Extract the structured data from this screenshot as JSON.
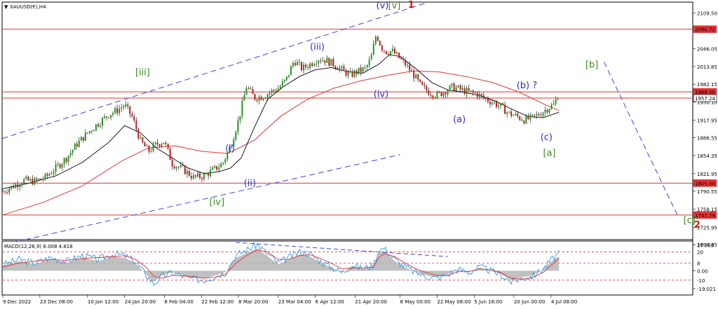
{
  "header": {
    "symbol_label": "XAUUSD(€),H4"
  },
  "macd_label": "MACD(12,26,9) 8.008 4.818",
  "colors": {
    "frame": "#000000",
    "price_line": "#000000",
    "candle_up": "#1a9a1a",
    "candle_down": "#c01818",
    "ma_fast": "#000000",
    "ma_slow": "#e53333",
    "hline": "#e53333",
    "channel": "#3b45d8",
    "projection": "#3b45d8",
    "wave_blue": "#3030c8",
    "wave_green": "#3d8a1f",
    "wave_red": "#dd1111",
    "macd_hist": "#b0b0b0",
    "macd_line": "#3a9ae0",
    "macd_signal": "#e03030",
    "macd_level": "#e53333"
  },
  "chart_data": {
    "type": "line",
    "title": "XAUUSD(€),H4",
    "price_axis": {
      "ylim": [
        1705,
        2128
      ],
      "ticks": [
        "2109.50",
        "2078.45",
        "2046.05",
        "2013.85",
        "1982.15",
        "1950.10",
        "1917.95",
        "1886.55",
        "1854.35",
        "1821.95",
        "1790.55",
        "1758.15",
        "1725.95",
        "1694.65"
      ]
    },
    "macd_axis": {
      "ylim": [
        -25,
        30
      ],
      "ticks": [
        "27.553",
        "0.00",
        "-19.021"
      ]
    },
    "time_axis": {
      "span_days": 215,
      "ticks": [
        {
          "label": "9 Dec 2022",
          "day": 0
        },
        {
          "label": "23 Dec 08:00",
          "day": 14
        },
        {
          "label": "10 Jan 12:00",
          "day": 32
        },
        {
          "label": "24 Jan 20:00",
          "day": 46
        },
        {
          "label": "8 Feb 04:00",
          "day": 61
        },
        {
          "label": "22 Feb 12:00",
          "day": 75
        },
        {
          "label": "8 Mar 20:00",
          "day": 89
        },
        {
          "label": "23 Mar 04:00",
          "day": 104
        },
        {
          "label": "6 Apr 12:00",
          "day": 118
        },
        {
          "label": "21 Apr 20:00",
          "day": 133
        },
        {
          "label": "8 May 00:00",
          "day": 150
        },
        {
          "label": "22 May 08:00",
          "day": 164
        },
        {
          "label": "5 Jun 16:00",
          "day": 178
        },
        {
          "label": "20 Jun 00:00",
          "day": 193
        },
        {
          "label": "4 Jul 08:00",
          "day": 207
        }
      ]
    },
    "price_series": {
      "name": "XAUUSD",
      "x": [
        0,
        4,
        8,
        12,
        16,
        20,
        24,
        28,
        32,
        36,
        40,
        43,
        46,
        49,
        52,
        55,
        58,
        61,
        64,
        68,
        72,
        76,
        80,
        83,
        86,
        89,
        92,
        95,
        98,
        101,
        104,
        107,
        110,
        113,
        116,
        119,
        122,
        125,
        128,
        131,
        134,
        137,
        139,
        141,
        143,
        145,
        147,
        149,
        152,
        155,
        158,
        161,
        164,
        167,
        170,
        173,
        176,
        179,
        182,
        185,
        188,
        191,
        194,
        197,
        200,
        203,
        206,
        208,
        210
      ],
      "y": [
        1790,
        1800,
        1810,
        1808,
        1815,
        1832,
        1850,
        1875,
        1895,
        1912,
        1928,
        1935,
        1945,
        1922,
        1880,
        1862,
        1875,
        1880,
        1840,
        1830,
        1815,
        1818,
        1830,
        1840,
        1872,
        1918,
        1978,
        1958,
        1960,
        1968,
        1975,
        1990,
        2025,
        2010,
        2018,
        2028,
        2025,
        2018,
        2008,
        1998,
        2005,
        2010,
        2028,
        2072,
        2048,
        2040,
        2042,
        2032,
        2018,
        2000,
        1978,
        1968,
        1962,
        1970,
        1978,
        1972,
        1968,
        1965,
        1956,
        1950,
        1942,
        1930,
        1925,
        1918,
        1922,
        1930,
        1940,
        1945,
        1965
      ]
    },
    "ma_fast": {
      "x": [
        0,
        10,
        20,
        30,
        40,
        46,
        52,
        58,
        64,
        70,
        76,
        82,
        86,
        90,
        95,
        100,
        106,
        112,
        118,
        124,
        130,
        136,
        142,
        146,
        150,
        156,
        162,
        168,
        174,
        180,
        186,
        192,
        198,
        204,
        210
      ],
      "y": [
        1795,
        1805,
        1818,
        1842,
        1878,
        1908,
        1895,
        1868,
        1850,
        1832,
        1822,
        1826,
        1832,
        1850,
        1905,
        1955,
        1978,
        1996,
        2008,
        2012,
        2005,
        2002,
        2018,
        2035,
        2032,
        2010,
        1985,
        1972,
        1968,
        1962,
        1952,
        1938,
        1925,
        1922,
        1932
      ]
    },
    "ma_slow": {
      "x": [
        0,
        15,
        30,
        45,
        55,
        65,
        75,
        85,
        95,
        105,
        115,
        125,
        135,
        145,
        155,
        165,
        175,
        185,
        195,
        205,
        210
      ],
      "y": [
        1748,
        1770,
        1800,
        1845,
        1868,
        1872,
        1862,
        1858,
        1882,
        1925,
        1955,
        1975,
        1988,
        1998,
        2006,
        2004,
        1996,
        1985,
        1968,
        1945,
        1935
      ]
    },
    "horizontal_levels": [
      {
        "label": "2080.72",
        "value": 2080.72
      },
      {
        "label": "1968.50",
        "value": 1968.5
      },
      {
        "label": "1957.24",
        "value": 1957.24
      },
      {
        "label": "1805.00",
        "value": 1805
      },
      {
        "label": "1747.79",
        "value": 1747.79
      }
    ],
    "channel_lines": [
      {
        "x1": -10,
        "y1": 1870,
        "x2": 160,
        "y2": 2128
      },
      {
        "x1": 5,
        "y1": 1700,
        "x2": 150,
        "y2": 1856
      }
    ],
    "projection_line": {
      "x1": 227,
      "y1": 2022,
      "x2": 255,
      "y2": 1745
    },
    "wave_labels": [
      {
        "text": "[v]",
        "x": 145.5,
        "y": 2118,
        "color": "green"
      },
      {
        "text": "(v)",
        "x": 141,
        "y": 2118,
        "color": "blue"
      },
      {
        "text": "1",
        "x": 153,
        "y": 2119,
        "color": "red"
      },
      {
        "text": "(iii)",
        "x": 116,
        "y": 2044,
        "color": "blue"
      },
      {
        "text": "[iii]",
        "x": 50,
        "y": 1998,
        "color": "green"
      },
      {
        "text": "(iv)",
        "x": 140,
        "y": 1959,
        "color": "blue"
      },
      {
        "text": "(i)",
        "x": 84,
        "y": 1862,
        "color": "blue"
      },
      {
        "text": "(ii)",
        "x": 91,
        "y": 1800,
        "color": "blue"
      },
      {
        "text": "[iv]",
        "x": 78,
        "y": 1766,
        "color": "green"
      },
      {
        "text": "(a)",
        "x": 170,
        "y": 1914,
        "color": "blue"
      },
      {
        "text": "(b) ?",
        "x": 194,
        "y": 1975,
        "color": "blue"
      },
      {
        "text": "(c)",
        "x": 203,
        "y": 1882,
        "color": "blue"
      },
      {
        "text": "[a]",
        "x": 204,
        "y": 1854,
        "color": "green"
      },
      {
        "text": "[b]",
        "x": 220,
        "y": 2012,
        "color": "green"
      },
      {
        "text": "[c]",
        "x": 257,
        "y": 1733,
        "color": "green"
      },
      {
        "text": "2",
        "x": 261,
        "y": 1725,
        "color": "red"
      }
    ],
    "macd": {
      "levels": [
        20,
        8,
        -10
      ],
      "x": [
        0,
        6,
        12,
        18,
        24,
        30,
        36,
        42,
        46,
        50,
        54,
        57,
        60,
        64,
        70,
        76,
        80,
        84,
        88,
        92,
        96,
        100,
        104,
        108,
        112,
        116,
        120,
        124,
        128,
        132,
        136,
        140,
        142,
        144,
        148,
        152,
        156,
        160,
        164,
        168,
        172,
        176,
        180,
        184,
        188,
        192,
        196,
        200,
        204,
        208,
        210
      ],
      "macd_line": [
        6,
        12,
        8,
        14,
        10,
        16,
        12,
        18,
        16,
        10,
        -4,
        -14,
        -6,
        -2,
        -8,
        -10,
        -6,
        -2,
        16,
        22,
        28,
        18,
        8,
        14,
        20,
        18,
        10,
        4,
        -2,
        6,
        2,
        6,
        22,
        24,
        12,
        4,
        -2,
        -6,
        -8,
        -4,
        2,
        -2,
        4,
        0,
        -4,
        -12,
        -8,
        -6,
        2,
        14,
        18
      ],
      "signal_line": [
        4,
        8,
        10,
        12,
        11,
        13,
        14,
        15,
        16,
        12,
        4,
        -6,
        -8,
        -5,
        -6,
        -8,
        -7,
        -4,
        8,
        16,
        22,
        20,
        12,
        12,
        16,
        17,
        13,
        8,
        2,
        3,
        3,
        4,
        14,
        18,
        15,
        8,
        2,
        -2,
        -5,
        -5,
        -1,
        -1,
        2,
        1,
        -2,
        -8,
        -9,
        -7,
        -2,
        8,
        13
      ],
      "divergence_line": {
        "x1": 88,
        "y1": 30,
        "x2": 168,
        "y2": 15
      }
    }
  }
}
